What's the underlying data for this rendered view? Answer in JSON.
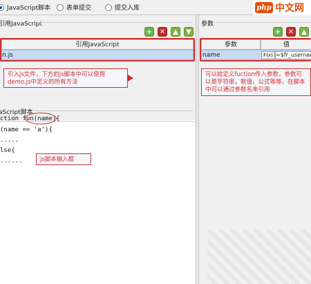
{
  "tabs": [
    {
      "label": "JavaScript脚本",
      "checked": true
    },
    {
      "label": "表单提交",
      "checked": false
    },
    {
      "label": "提交入库",
      "checked": false
    }
  ],
  "watermark": {
    "logo": "php",
    "text": "中文网"
  },
  "left_panel": {
    "group_title": "引用JavaScript",
    "table_header": "引用JavaScript",
    "row_value": "n.js",
    "callout": "引入js文件，下方的js脚本中可以使用demo.js中定义的所有方法"
  },
  "right_panel": {
    "group_title": "参数",
    "col_param": "参数",
    "col_value": "值",
    "row_param": "name",
    "row_fx": "F(x)",
    "row_value": "=$fr_usernam",
    "callout": "可以给定义fuction传入参数，参数可以是字符串，数值，公式等等，在脚本中可以通过参数名来引用"
  },
  "editor": {
    "group_title": "aScript脚本",
    "lines": [
      "ction fun(name){",
      "(name == 'a'){",
      ".....",
      "lse{",
      "......"
    ],
    "callout": "js脚本输入框"
  },
  "colors": {
    "accent_red": "#d23030",
    "selection": "#c9daf0",
    "brand_orange": "#e8500b"
  }
}
